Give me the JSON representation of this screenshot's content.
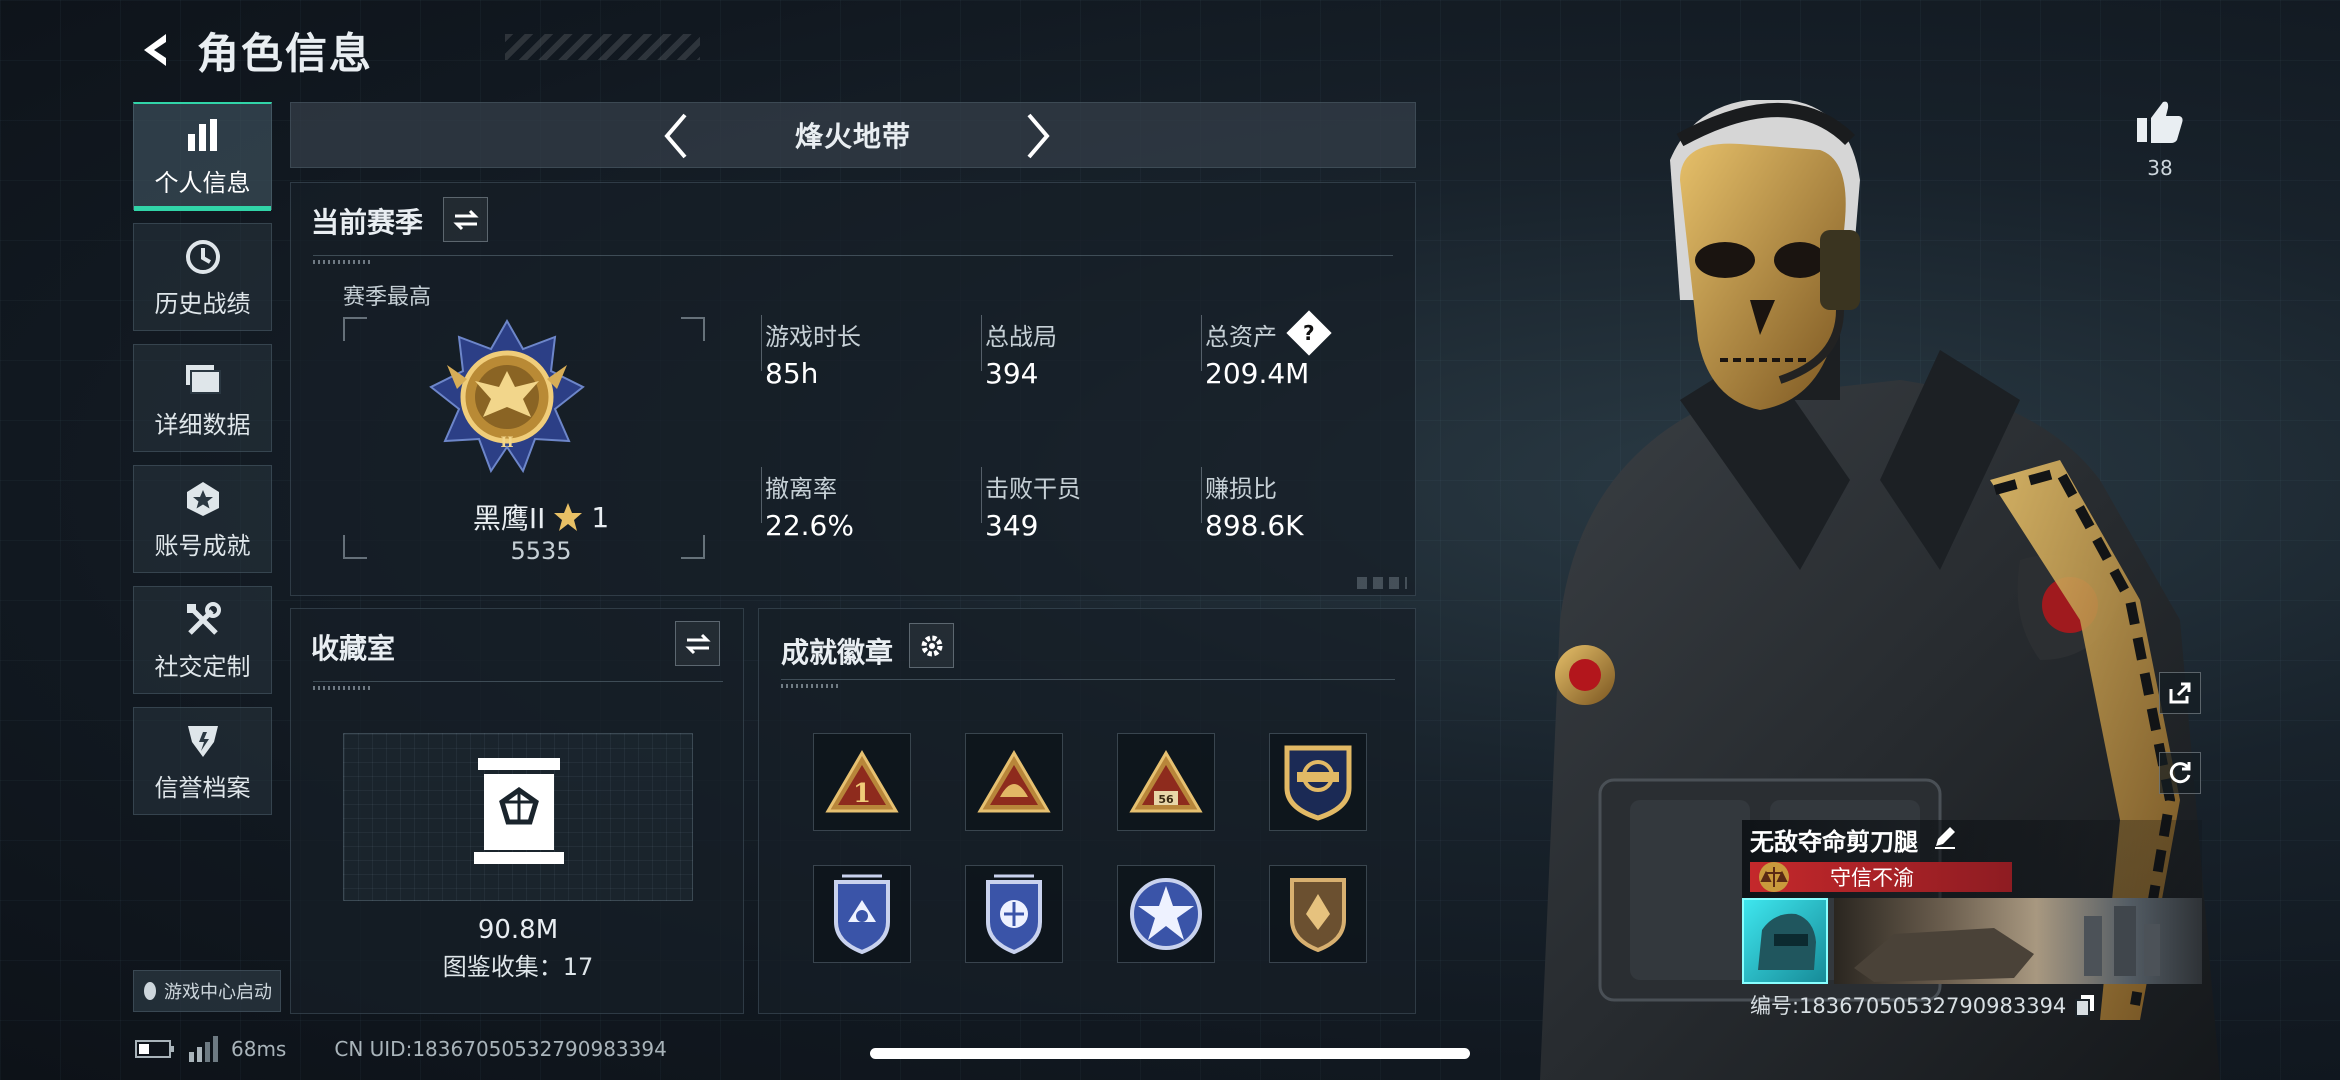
{
  "header": {
    "title": "角色信息"
  },
  "sidebar": {
    "items": [
      {
        "label": "个人信息",
        "icon": "bar-chart-icon",
        "active": true
      },
      {
        "label": "历史战绩",
        "icon": "clock-history-icon"
      },
      {
        "label": "详细数据",
        "icon": "folder-icon"
      },
      {
        "label": "账号成就",
        "icon": "achievement-star-icon"
      },
      {
        "label": "社交定制",
        "icon": "wrench-screwdriver-icon"
      },
      {
        "label": "信誉档案",
        "icon": "reputation-shield-icon"
      }
    ],
    "launch_label": "游戏中心启动"
  },
  "mode": {
    "title": "烽火地带"
  },
  "season": {
    "title": "当前赛季",
    "best_label": "赛季最高",
    "rank_name": "黑鹰II",
    "rank_stars": "1",
    "rank_score": "5535",
    "stats": [
      {
        "label": "游戏时长",
        "value": "85h"
      },
      {
        "label": "总战局",
        "value": "394"
      },
      {
        "label": "总资产",
        "value": "209.4M"
      },
      {
        "label": "撤离率",
        "value": "22.6%"
      },
      {
        "label": "击败干员",
        "value": "349"
      },
      {
        "label": "赚损比",
        "value": "898.6K"
      }
    ],
    "help_glyph": "?"
  },
  "collection": {
    "title": "收藏室",
    "value": "90.8M",
    "catalog_label": "图鉴收集：17"
  },
  "badges": {
    "title": "成就徽章",
    "items": [
      {
        "name": "triangle-badge-1",
        "text": "1"
      },
      {
        "name": "triangle-badge-helmet"
      },
      {
        "name": "triangle-badge-56",
        "text": "56"
      },
      {
        "name": "shield-badge-gold"
      },
      {
        "name": "shield-badge-blue-1"
      },
      {
        "name": "shield-badge-blue-2"
      },
      {
        "name": "star-badge-blue"
      },
      {
        "name": "shield-badge-bronze"
      }
    ]
  },
  "likes": {
    "count": "38"
  },
  "profile": {
    "nickname": "无敌夺命剪刀腿",
    "motto": "守信不渝",
    "id_line": "编号:18367050532790983394"
  },
  "footer": {
    "ping": "68ms",
    "uid": "CN UID:18367050532790983394"
  },
  "colors": {
    "accent": "#31d4a8",
    "motto_red": "#c4282b",
    "gold": "#c99a3c"
  }
}
